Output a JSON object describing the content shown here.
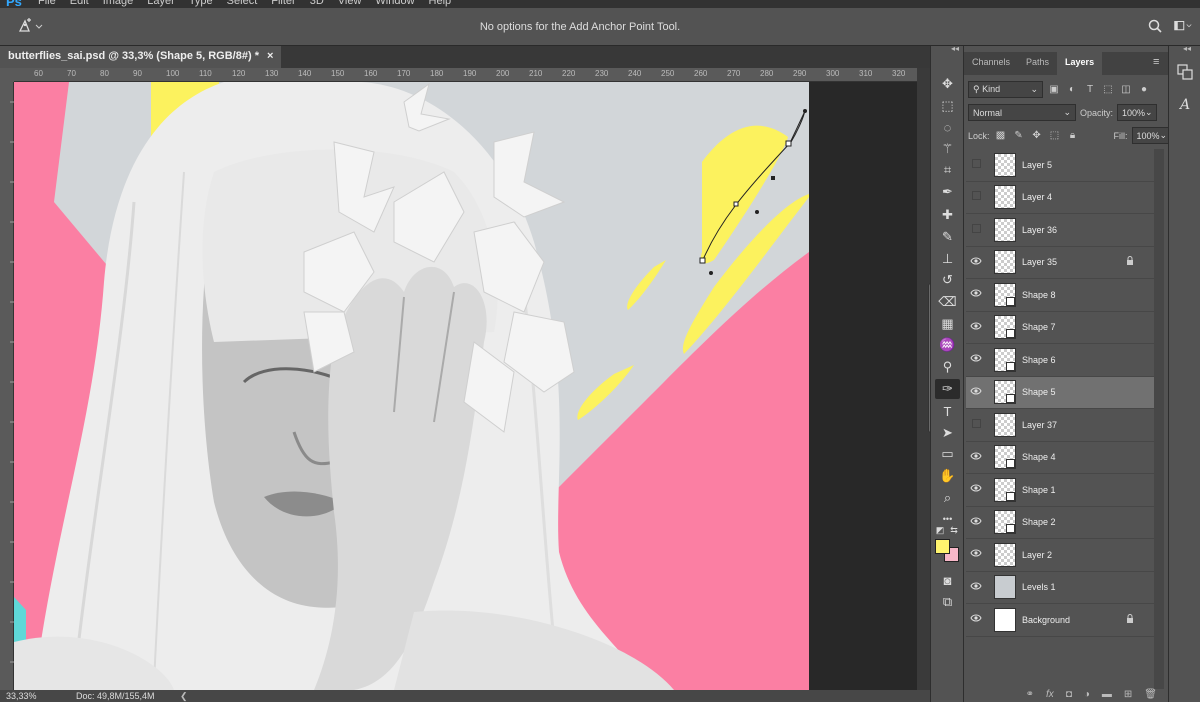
{
  "app": {
    "logo": "Ps",
    "menus": [
      "File",
      "Edit",
      "Image",
      "Layer",
      "Type",
      "Select",
      "Filter",
      "3D",
      "View",
      "Window",
      "Help"
    ]
  },
  "options": {
    "tool_icon": "add-anchor-point-icon",
    "message": "No options for the Add Anchor Point Tool."
  },
  "document": {
    "tab_title": "butterflies_sai.psd @ 33,3% (Shape 5, RGB/8#) *",
    "close": "×"
  },
  "ruler": {
    "top_ticks": [
      "60",
      "70",
      "80",
      "90",
      "100",
      "110",
      "120",
      "130",
      "140",
      "150",
      "160",
      "170",
      "180",
      "190",
      "200",
      "210",
      "220",
      "230",
      "240",
      "250",
      "260",
      "270",
      "280",
      "290",
      "300",
      "310",
      "320"
    ]
  },
  "status": {
    "zoom": "33,33%",
    "doc": "Doc: 49,8M/155,4M"
  },
  "toolbar": {
    "tools": [
      "move-icon",
      "marquee-icon",
      "lasso-icon",
      "magic-wand-icon",
      "crop-icon",
      "eyedropper-icon",
      "healing-brush-icon",
      "brush-icon",
      "clone-stamp-icon",
      "history-brush-icon",
      "eraser-icon",
      "gradient-icon",
      "blur-icon",
      "dodge-icon",
      "pen-icon",
      "type-icon",
      "path-selection-icon",
      "rectangle-icon",
      "hand-icon",
      "zoom-icon",
      "more-tools-icon"
    ],
    "active_tool": "pen-icon",
    "foreground_color": "#fff46e",
    "background_color": "#f7b7c8"
  },
  "panel": {
    "tabs": [
      "Channels",
      "Paths",
      "Layers"
    ],
    "active_tab": "Layers",
    "filter_label": "Kind",
    "blend_mode": "Normal",
    "opacity_label": "Opacity:",
    "opacity_value": "100%",
    "lock_label": "Lock:",
    "fill_label": "Fill:",
    "fill_value": "100%",
    "layers": [
      {
        "name": "Layer 5",
        "visible": false,
        "locked": false,
        "thumb": "checker"
      },
      {
        "name": "Layer 4",
        "visible": false,
        "locked": false,
        "thumb": "checker"
      },
      {
        "name": "Layer 36",
        "visible": false,
        "locked": false,
        "thumb": "checker"
      },
      {
        "name": "Layer 35",
        "visible": true,
        "locked": true,
        "thumb": "checker"
      },
      {
        "name": "Shape 8",
        "visible": true,
        "locked": false,
        "thumb": "shape"
      },
      {
        "name": "Shape 7",
        "visible": true,
        "locked": false,
        "thumb": "shape"
      },
      {
        "name": "Shape 6",
        "visible": true,
        "locked": false,
        "thumb": "shape"
      },
      {
        "name": "Shape 5",
        "visible": true,
        "locked": false,
        "thumb": "shape",
        "selected": true
      },
      {
        "name": "Layer 37",
        "visible": false,
        "locked": false,
        "thumb": "checker"
      },
      {
        "name": "Shape 4",
        "visible": true,
        "locked": false,
        "thumb": "shape"
      },
      {
        "name": "Shape 1",
        "visible": true,
        "locked": false,
        "thumb": "shape"
      },
      {
        "name": "Shape 2",
        "visible": true,
        "locked": false,
        "thumb": "shape"
      },
      {
        "name": "Layer 2",
        "visible": true,
        "locked": false,
        "thumb": "checker"
      },
      {
        "name": "Levels 1",
        "visible": true,
        "locked": false,
        "thumb": "grey"
      },
      {
        "name": "Background",
        "visible": true,
        "locked": true,
        "thumb": "solid"
      }
    ],
    "footer_icons": [
      "link-icon",
      "fx-icon",
      "mask-icon",
      "adjustment-icon",
      "group-icon",
      "new-layer-icon",
      "trash-icon"
    ]
  },
  "colors": {
    "pink": "#fb7fa3",
    "yellow": "#fcf25e",
    "sky": "#d2d6d9",
    "cyan": "#5fd8d8"
  }
}
